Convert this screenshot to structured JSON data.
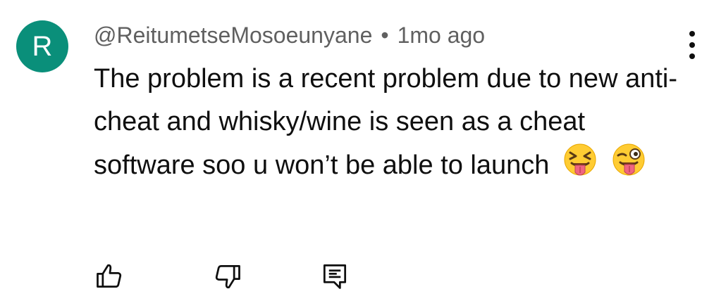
{
  "author": {
    "avatar_letter": "R",
    "avatar_color": "#0a8f7a",
    "handle": "@ReitumetseMosoeunyane",
    "separator": "•",
    "timestamp": "1mo ago"
  },
  "comment": {
    "text": "The problem is a recent problem due to new anti-cheat and whisky/wine is seen as a cheat software soo u won’t be able to launch",
    "emojis": [
      "squinting-face-with-tongue",
      "winking-face-with-tongue"
    ]
  },
  "actions": {
    "like_icon": "thumbs-up-icon",
    "dislike_icon": "thumbs-down-icon",
    "reply_icon": "comment-reply-icon",
    "more_icon": "more-vertical-icon"
  }
}
